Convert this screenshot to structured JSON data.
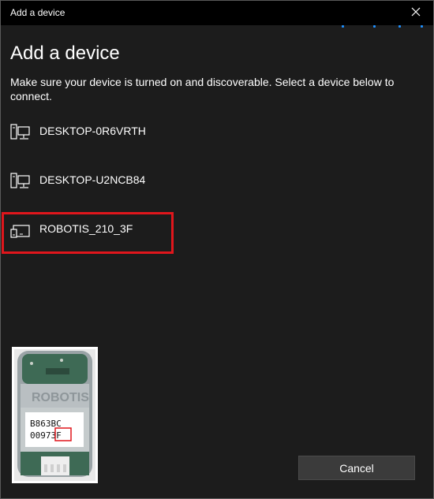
{
  "window": {
    "title": "Add a device",
    "close_icon": "close-icon",
    "accent": "#1e90ff"
  },
  "main": {
    "heading": "Add a device",
    "instructions": "Make sure your device is turned on and discoverable. Select a device below to connect."
  },
  "devices": [
    {
      "name": "DESKTOP-0R6VRTH",
      "icon": "desktop-computer-icon"
    },
    {
      "name": "DESKTOP-U2NCB84",
      "icon": "desktop-computer-icon"
    },
    {
      "name": "ROBOTIS_210_3F",
      "icon": "generic-device-icon",
      "highlighted": true
    }
  ],
  "highlight_color": "#e0161c",
  "photo": {
    "brand": "ROBOTIS",
    "label_line1": "B863BC",
    "label_line2": "00973F"
  },
  "footer": {
    "cancel_label": "Cancel"
  }
}
